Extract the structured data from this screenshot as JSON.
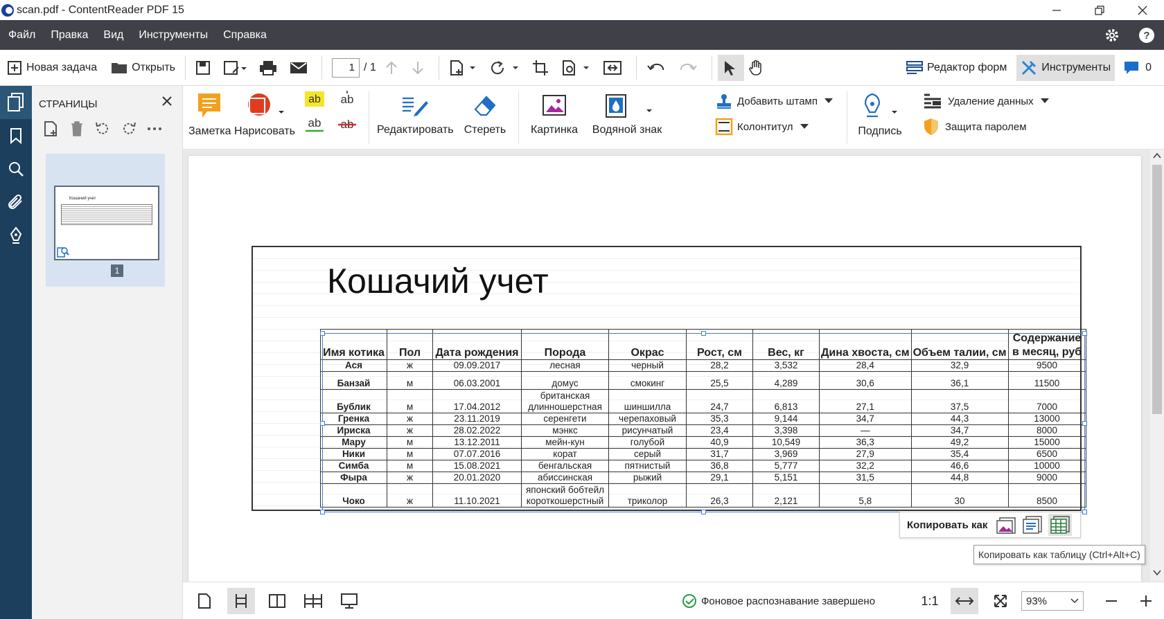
{
  "window": {
    "title": "scan.pdf - ContentReader PDF 15"
  },
  "menu": [
    "Файл",
    "Правка",
    "Вид",
    "Инструменты",
    "Справка"
  ],
  "toolbar": {
    "new_task": "Новая задача",
    "open": "Открыть",
    "page_current": "1",
    "page_total": "/ 1",
    "forms_editor": "Редактор форм",
    "tools": "Инструменты",
    "comments_count": "0"
  },
  "pages_panel": {
    "title": "СТРАНИЦЫ",
    "page_number": "1"
  },
  "ribbon": {
    "note": "Заметка",
    "draw": "Нарисовать",
    "text_highlight": "ab",
    "edit": "Редактировать",
    "erase": "Стереть",
    "image": "Картинка",
    "watermark": "Водяной знак",
    "add_stamp": "Добавить штамп",
    "header_footer": "Колонтитул",
    "signature": "Подпись",
    "redaction": "Удаление данных",
    "password_protect": "Защита паролем"
  },
  "document": {
    "title": "Кошачий учет",
    "thumb_title": "Кошачий учет",
    "headers": [
      "Имя котика",
      "Пол",
      "Дата рождения",
      "Порода",
      "Окрас",
      "Рост, см",
      "Вес, кг",
      "Дина хвоста, см",
      "Объем талии, см",
      "Содержание в месяц, руб"
    ],
    "rows": [
      [
        "Ася",
        "ж",
        "09.09.2017",
        "лесная",
        "черный",
        "28,2",
        "3,532",
        "28,4",
        "32,9",
        "9500"
      ],
      [
        "Банзай",
        "м",
        "06.03.2001",
        "домус",
        "смокинг",
        "25,5",
        "4,289",
        "30,6",
        "36,1",
        "11500"
      ],
      [
        "Бублик",
        "м",
        "17.04.2012",
        "британская длинношерстная",
        "шиншилла",
        "24,7",
        "6,813",
        "27,1",
        "37,5",
        "7000"
      ],
      [
        "Гренка",
        "ж",
        "23.11.2019",
        "серенгети",
        "черепаховый",
        "35,3",
        "9,144",
        "34,7",
        "44,3",
        "13000"
      ],
      [
        "Ириска",
        "ж",
        "28.02.2022",
        "мэнкс",
        "рисунчатый",
        "23,4",
        "3,398",
        "—",
        "34,7",
        "8000"
      ],
      [
        "Мару",
        "м",
        "13.12.2011",
        "мейн-кун",
        "голубой",
        "40,9",
        "10,549",
        "36,3",
        "49,2",
        "15000"
      ],
      [
        "Ники",
        "м",
        "07.07.2016",
        "корат",
        "серый",
        "31,7",
        "3,969",
        "27,9",
        "35,4",
        "6500"
      ],
      [
        "Симба",
        "м",
        "15.08.2021",
        "бенгальская",
        "пятнистый",
        "36,8",
        "5,777",
        "32,2",
        "46,6",
        "10000"
      ],
      [
        "Фыра",
        "ж",
        "20.01.2020",
        "абиссинская",
        "рыжий",
        "29,1",
        "5,151",
        "31,5",
        "44,8",
        "9000"
      ],
      [
        "Чоко",
        "ж",
        "11.10.2021",
        "японский бобтейл короткошерстный",
        "триколор",
        "26,3",
        "2,121",
        "5,8",
        "30",
        "8500"
      ]
    ]
  },
  "copy_bar": {
    "label": "Копировать как",
    "tooltip": "Копировать как таблицу (Ctrl+Alt+C)"
  },
  "status": {
    "recognition": "Фоновое распознавание завершено",
    "ratio": "1:1",
    "zoom": "93%"
  }
}
